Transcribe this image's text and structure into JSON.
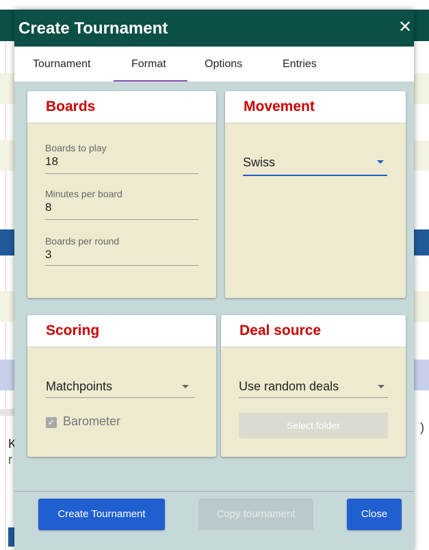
{
  "dialog": {
    "title": "Create Tournament",
    "close_glyph": "✕"
  },
  "tabs": [
    {
      "label": "Tournament",
      "active": false
    },
    {
      "label": "Format",
      "active": true
    },
    {
      "label": "Options",
      "active": false
    },
    {
      "label": "Entries",
      "active": false
    }
  ],
  "boards": {
    "title": "Boards",
    "fields": [
      {
        "label": "Boards to play",
        "value": "18"
      },
      {
        "label": "Minutes per board",
        "value": "8"
      },
      {
        "label": "Boards per round",
        "value": "3"
      }
    ]
  },
  "movement": {
    "title": "Movement",
    "selected": "Swiss"
  },
  "scoring": {
    "title": "Scoring",
    "selected": "Matchpoints",
    "barometer_label": "Barometer",
    "barometer_checked": true
  },
  "deal_source": {
    "title": "Deal source",
    "selected": "Use random deals",
    "select_folder_label": "Select folder"
  },
  "footer": {
    "create_label": "Create Tournament",
    "copy_label": "Copy tournament",
    "close_label": "Close"
  },
  "background": {
    "left_k": "K",
    "left_r": "r",
    "right_paren": ")"
  },
  "colors": {
    "header": "#0b4f45",
    "accent_red": "#cc0000",
    "primary_blue": "#1f5fd0",
    "tab_indicator": "#8e4fb8",
    "dialog_body": "#c6d8d8",
    "card_body": "#eeeacf"
  }
}
